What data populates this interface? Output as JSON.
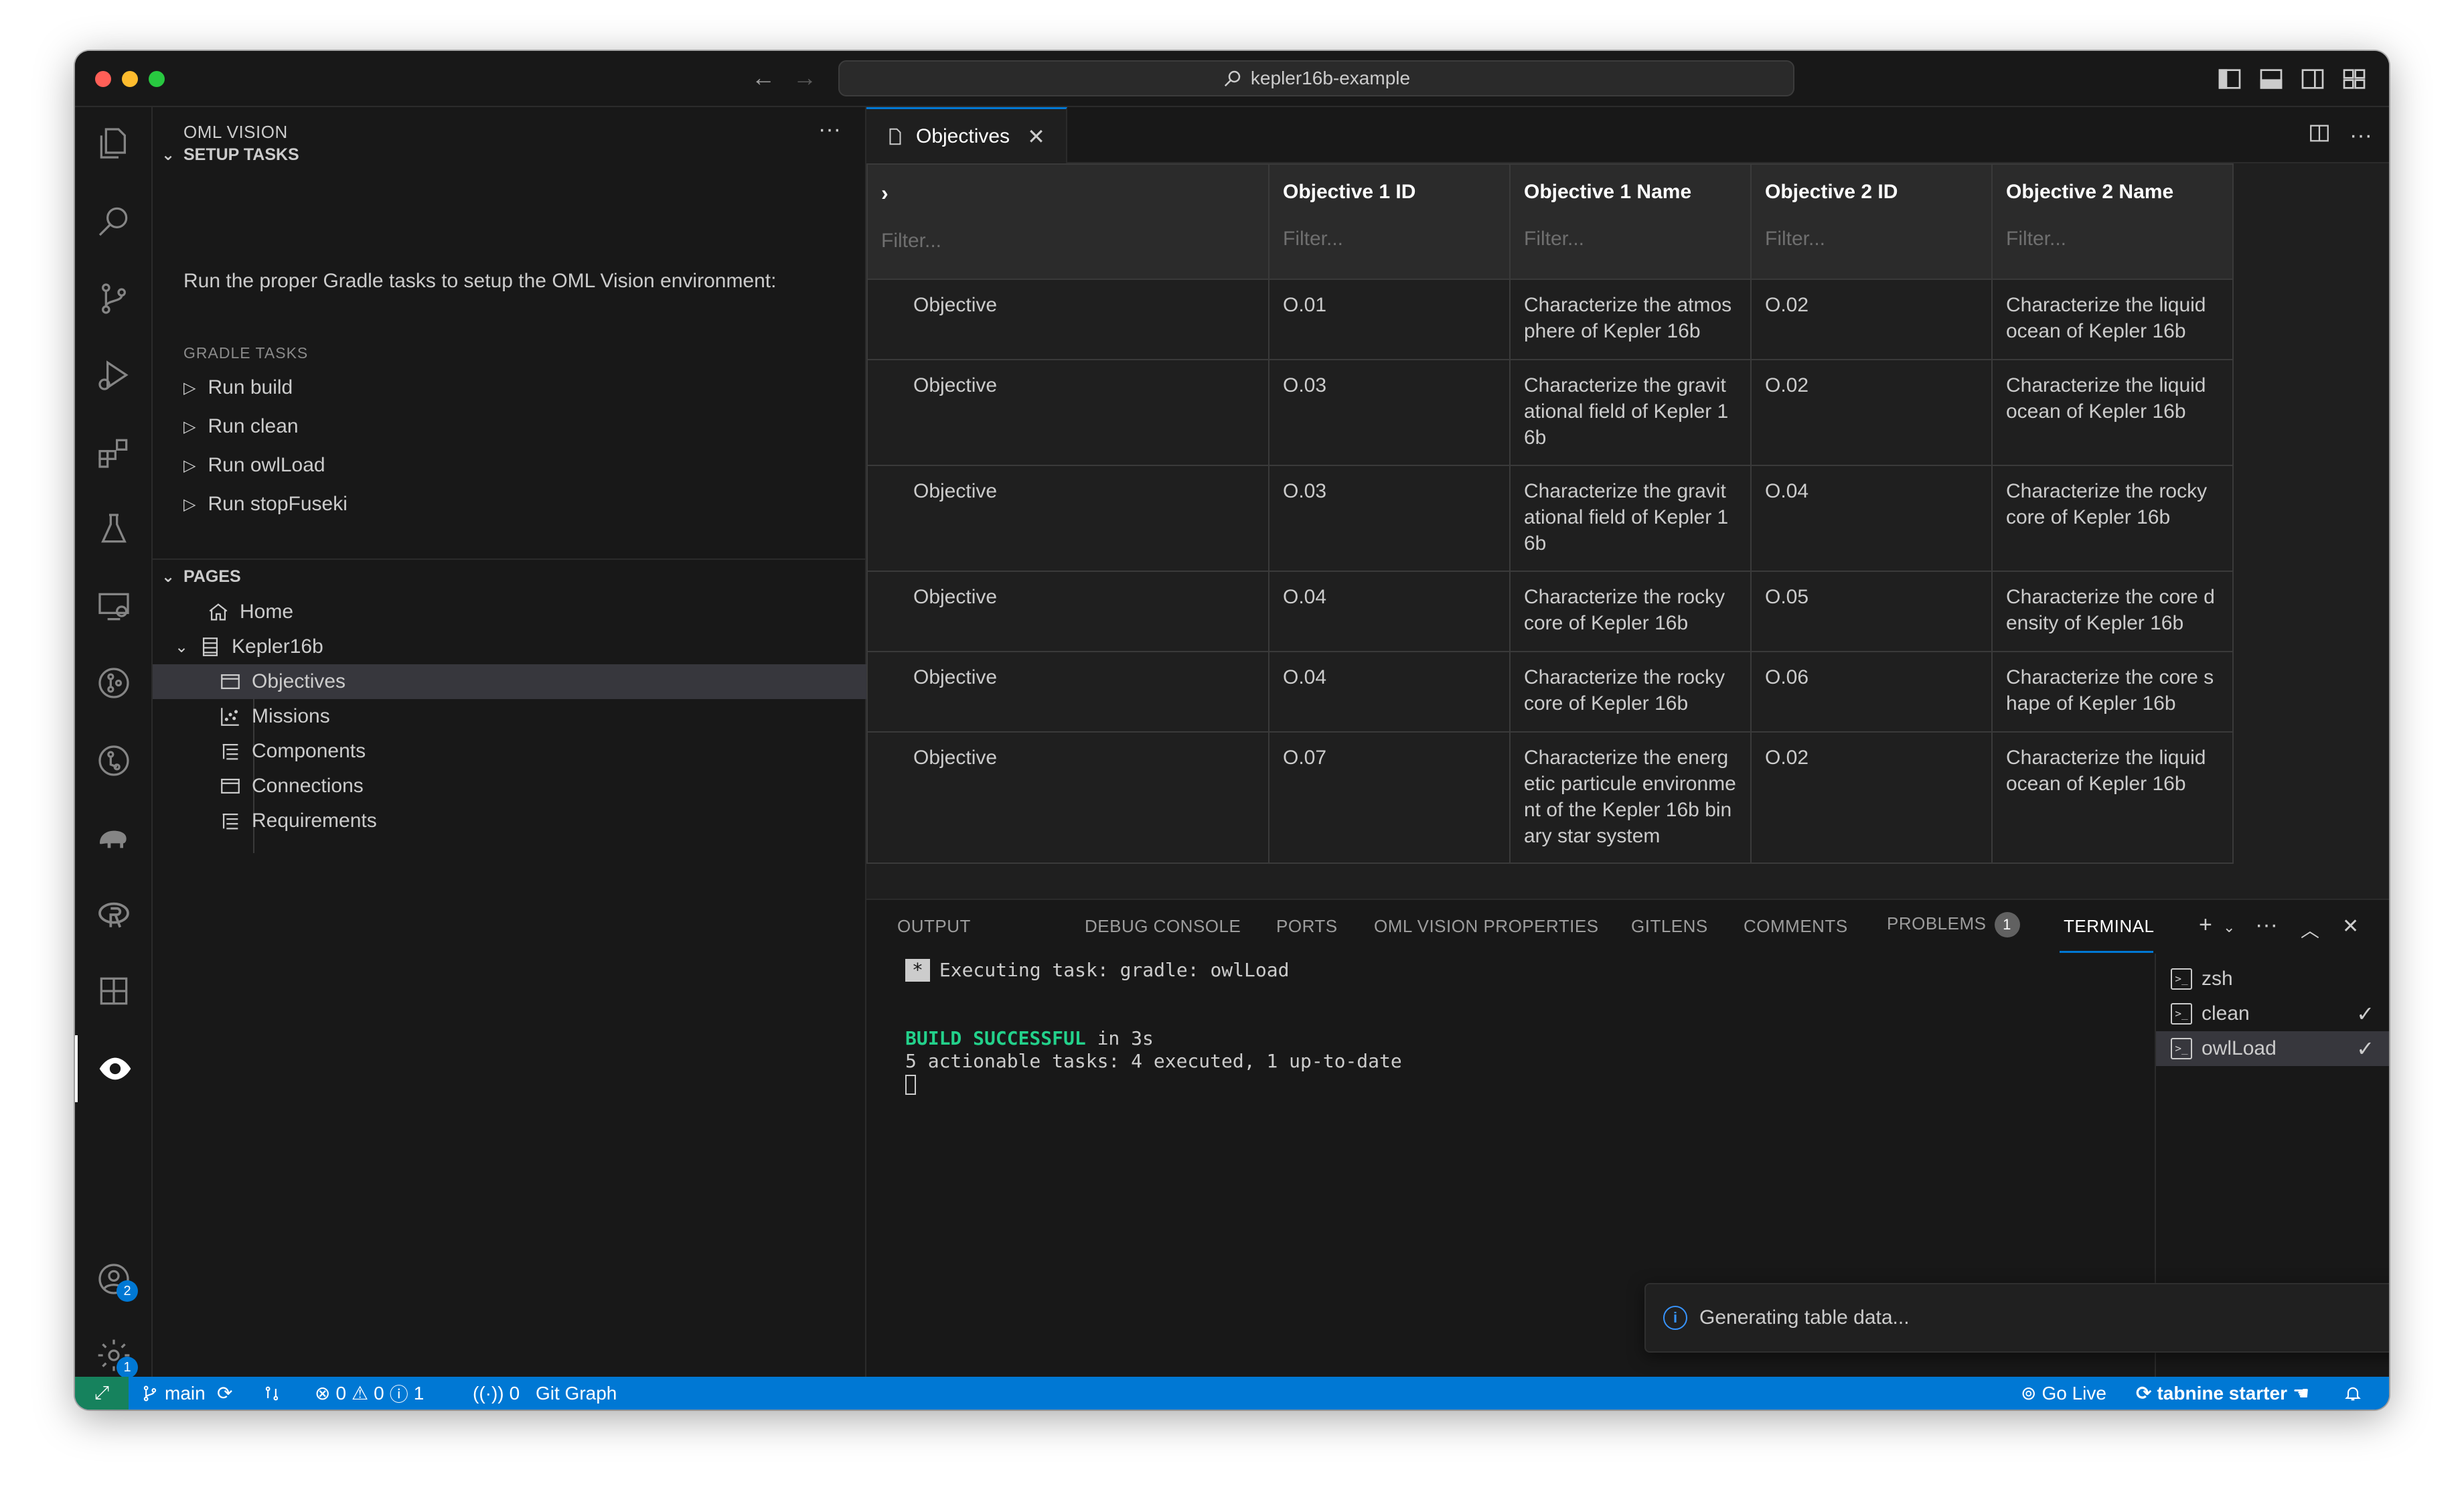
{
  "window": {
    "search_text": "kepler16b-example"
  },
  "sidebar": {
    "title": "OML VISION",
    "setup": {
      "header": "SETUP TASKS",
      "description": "Run the proper Gradle tasks to setup the OML Vision environment:",
      "gradle_header": "GRADLE TASKS",
      "tasks": [
        "Run build",
        "Run clean",
        "Run owlLoad",
        "Run stopFuseki"
      ]
    },
    "pages": {
      "header": "PAGES",
      "home": "Home",
      "group": "Kepler16b",
      "children": [
        "Objectives",
        "Missions",
        "Components",
        "Connections",
        "Requirements"
      ]
    }
  },
  "editor": {
    "tab_label": "Objectives",
    "table": {
      "columns": [
        "",
        "Objective 1 ID",
        "Objective 1 Name",
        "Objective 2 ID",
        "Objective 2 Name"
      ],
      "filter_placeholder": "Filter...",
      "rows": [
        [
          "Objective",
          "O.01",
          "Characterize the atmosphere of Kepler 16b",
          "O.02",
          "Characterize the liquid ocean of Kepler 16b"
        ],
        [
          "Objective",
          "O.03",
          "Characterize the gravitational field of Kepler 16b",
          "O.02",
          "Characterize the liquid ocean of Kepler 16b"
        ],
        [
          "Objective",
          "O.03",
          "Characterize the gravitational field of Kepler 16b",
          "O.04",
          "Characterize the rocky core of Kepler 16b"
        ],
        [
          "Objective",
          "O.04",
          "Characterize the rocky core of Kepler 16b",
          "O.05",
          "Characterize the core density of Kepler 16b"
        ],
        [
          "Objective",
          "O.04",
          "Characterize the rocky core of Kepler 16b",
          "O.06",
          "Characterize the core shape of Kepler 16b"
        ],
        [
          "Objective",
          "O.07",
          "Characterize the energetic particule environment of the Kepler 16b binary star system",
          "O.02",
          "Characterize the liquid ocean of Kepler 16b"
        ]
      ]
    }
  },
  "panel": {
    "tabs": [
      "OUTPUT",
      "DEBUG CONSOLE",
      "PORTS",
      "OML VISION PROPERTIES",
      "GITLENS",
      "COMMENTS",
      "PROBLEMS",
      "TERMINAL"
    ],
    "problems_count": "1",
    "terminal": {
      "star": "*",
      "exec_line": "Executing task: gradle: owlLoad",
      "build_ok": "BUILD SUCCESSFUL",
      "build_time": " in 3s",
      "summary": "5 actionable tasks: 4 executed, 1 up-to-date"
    },
    "terminals": [
      "zsh",
      "clean",
      "owlLoad"
    ]
  },
  "notification": {
    "text": "Generating table data..."
  },
  "statusbar": {
    "branch": "main",
    "errors": "0",
    "warnings": "0",
    "infos": "1",
    "ports": "0",
    "git_graph": "Git Graph",
    "go_live": "Go Live",
    "tabnine": "tabnine starter"
  },
  "activity": {
    "accounts_badge": "2",
    "settings_badge": "1"
  },
  "colors": {
    "accent": "#0078d4",
    "remote": "#16825d",
    "success": "#23d18b"
  }
}
